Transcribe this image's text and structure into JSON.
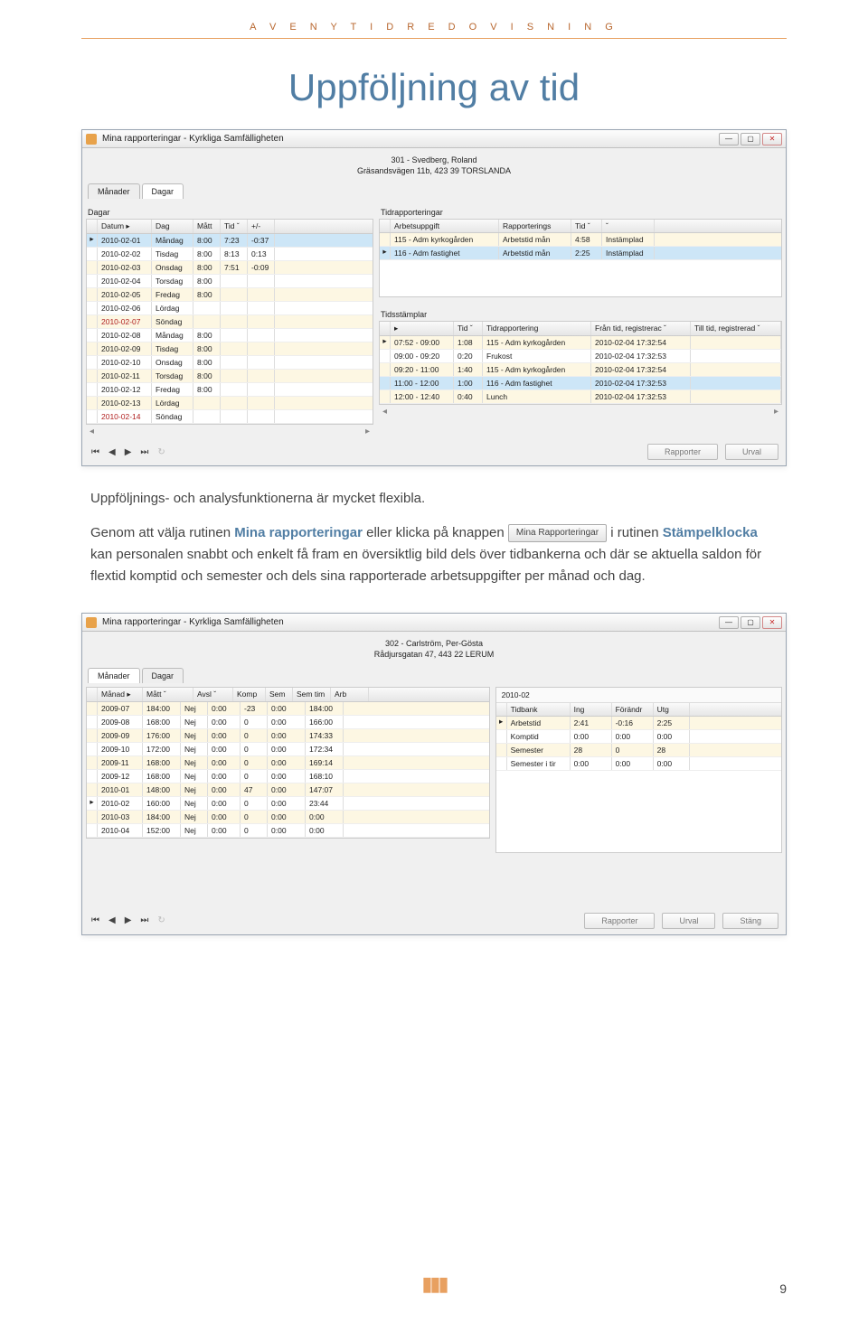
{
  "header": {
    "brand": "A V E N Y   T I D R E D O V I S N I N G"
  },
  "title": "Uppföljning av tid",
  "page_number": "9",
  "screenshot1": {
    "window_title": "Mina rapporteringar - Kyrkliga Samfälligheten",
    "person_line1": "301 - Svedberg, Roland",
    "person_line2": "Gräsandsvägen 11b, 423 39  TORSLANDA",
    "tab_months": "Månader",
    "tab_days": "Dagar",
    "left_label": "Dagar",
    "right_label_top": "Tidrapporteringar",
    "right_label_mid": "Tidsstämplar",
    "days_cols": [
      "Datum   ▸",
      "Dag",
      "Mått",
      "Tid  ˇ",
      "+/-"
    ],
    "days_rows": [
      [
        "2010-02-01",
        "Måndag",
        "8:00",
        "7:23",
        "-0:37",
        false,
        true
      ],
      [
        "2010-02-02",
        "Tisdag",
        "8:00",
        "8:13",
        "0:13",
        false,
        false
      ],
      [
        "2010-02-03",
        "Onsdag",
        "8:00",
        "7:51",
        "-0:09",
        false,
        false
      ],
      [
        "2010-02-04",
        "Torsdag",
        "8:00",
        "",
        "",
        false,
        false
      ],
      [
        "2010-02-05",
        "Fredag",
        "8:00",
        "",
        "",
        false,
        false
      ],
      [
        "2010-02-06",
        "Lördag",
        "",
        "",
        "",
        false,
        false
      ],
      [
        "2010-02-07",
        "Söndag",
        "",
        "",
        "",
        true,
        false
      ],
      [
        "2010-02-08",
        "Måndag",
        "8:00",
        "",
        "",
        false,
        false
      ],
      [
        "2010-02-09",
        "Tisdag",
        "8:00",
        "",
        "",
        false,
        false
      ],
      [
        "2010-02-10",
        "Onsdag",
        "8:00",
        "",
        "",
        false,
        false
      ],
      [
        "2010-02-11",
        "Torsdag",
        "8:00",
        "",
        "",
        false,
        false
      ],
      [
        "2010-02-12",
        "Fredag",
        "8:00",
        "",
        "",
        false,
        false
      ],
      [
        "2010-02-13",
        "Lördag",
        "",
        "",
        "",
        false,
        false
      ],
      [
        "2010-02-14",
        "Söndag",
        "",
        "",
        "",
        true,
        false
      ]
    ],
    "reports_cols": [
      "Arbetsuppgift",
      "Rapporterings",
      "Tid  ˇ",
      "ˇ"
    ],
    "reports_rows": [
      [
        "115 - Adm kyrkogården",
        "Arbetstid mån",
        "4:58",
        "Instämplad",
        false
      ],
      [
        "116 - Adm fastighet",
        "Arbetstid mån",
        "2:25",
        "Instämplad",
        true
      ]
    ],
    "stamps_cols": [
      "▸",
      "Tid  ˇ",
      "Tidrapportering",
      "Från tid, registrerac ˇ",
      "Till tid, registrerad  ˇ"
    ],
    "stamps_rows": [
      [
        "07:52 - 09:00",
        "1:08",
        "115 - Adm kyrkogården",
        "2010-02-04 17:32:54",
        "",
        false
      ],
      [
        "09:00 - 09:20",
        "0:20",
        "Frukost",
        "2010-02-04 17:32:53",
        "",
        false
      ],
      [
        "09:20 - 11:00",
        "1:40",
        "115 - Adm kyrkogården",
        "2010-02-04 17:32:54",
        "",
        false
      ],
      [
        "11:00 - 12:00",
        "1:00",
        "116 - Adm fastighet",
        "2010-02-04 17:32:53",
        "",
        true
      ],
      [
        "12:00 - 12:40",
        "0:40",
        "Lunch",
        "2010-02-04 17:32:53",
        "",
        false
      ]
    ],
    "btn_rapporter": "Rapporter",
    "btn_urval": "Urval"
  },
  "para": {
    "lead": "Uppföljnings- och analysfunktionerna är mycket flexibla.",
    "t1": "Genom att välja rutinen ",
    "b1": "Mina rapporteringar",
    "t2": " eller klicka på knappen ",
    "inline_btn": "Mina Rapporteringar",
    "t3": " i rutinen ",
    "b2": "Stämpelklocka",
    "t4": " kan personalen snabbt och enkelt få fram en översiktlig bild dels över tidbankerna och där se aktuella saldon för flextid komptid och semester och dels sina rapporterade arbetsuppgifter per månad och dag."
  },
  "screenshot2": {
    "window_title": "Mina rapporteringar - Kyrkliga Samfälligheten",
    "person_line1": "302 - Carlström, Per-Gösta",
    "person_line2": "Rådjursgatan 47, 443 22  LERUM",
    "tab_months": "Månader",
    "tab_days": "Dagar",
    "months_cols": [
      "Månad  ▸",
      "Mått",
      "ˇ",
      "Avsl",
      "ˇ",
      "Komp",
      "Sem",
      "Sem tim",
      "Arb"
    ],
    "months_rows": [
      [
        "2009-07",
        "184:00",
        "Nej",
        "0:00",
        "-23",
        "0:00",
        "184:00"
      ],
      [
        "2009-08",
        "168:00",
        "Nej",
        "0:00",
        "0",
        "0:00",
        "166:00"
      ],
      [
        "2009-09",
        "176:00",
        "Nej",
        "0:00",
        "0",
        "0:00",
        "174:33"
      ],
      [
        "2009-10",
        "172:00",
        "Nej",
        "0:00",
        "0",
        "0:00",
        "172:34"
      ],
      [
        "2009-11",
        "168:00",
        "Nej",
        "0:00",
        "0",
        "0:00",
        "169:14"
      ],
      [
        "2009-12",
        "168:00",
        "Nej",
        "0:00",
        "0",
        "0:00",
        "168:10"
      ],
      [
        "2010-01",
        "148:00",
        "Nej",
        "0:00",
        "47",
        "0:00",
        "147:07"
      ],
      [
        "2010-02",
        "160:00",
        "Nej",
        "0:00",
        "0",
        "0:00",
        "23:44"
      ],
      [
        "2010-03",
        "184:00",
        "Nej",
        "0:00",
        "0",
        "0:00",
        "0:00"
      ],
      [
        "2010-04",
        "152:00",
        "Nej",
        "0:00",
        "0",
        "0:00",
        "0:00"
      ]
    ],
    "months_selected_index": 7,
    "right_title": "2010-02",
    "tidbank_cols": [
      "Tidbank",
      "Ing",
      "Förändr",
      "Utg"
    ],
    "tidbank_rows": [
      [
        "Arbetstid",
        "2:41",
        "-0:16",
        "2:25"
      ],
      [
        "Komptid",
        "0:00",
        "0:00",
        "0:00"
      ],
      [
        "Semester",
        "28",
        "0",
        "28"
      ],
      [
        "Semester i tir",
        "0:00",
        "0:00",
        "0:00"
      ]
    ],
    "btn_rapporter": "Rapporter",
    "btn_urval": "Urval",
    "btn_stang": "Stäng"
  }
}
